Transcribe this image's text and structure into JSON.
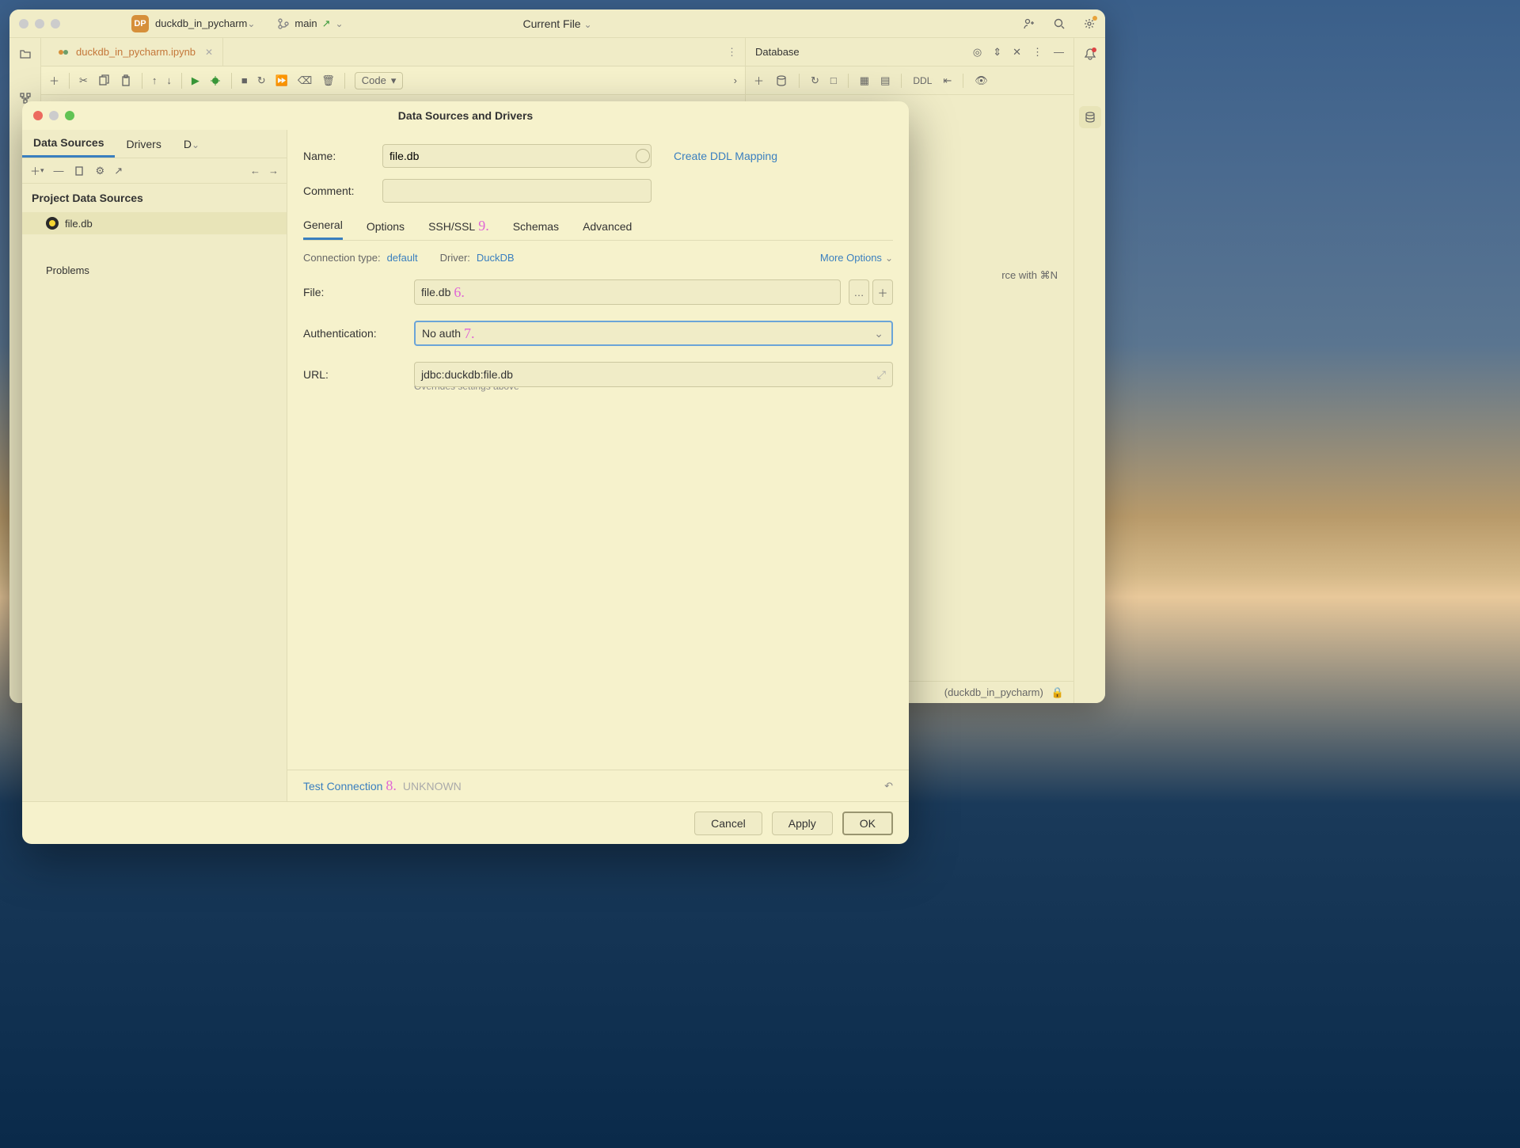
{
  "window": {
    "project_badge": "DP",
    "project_name": "duckdb_in_pycharm",
    "branch": "main",
    "current_file": "Current File"
  },
  "tabs": {
    "file": "duckdb_in_pycharm.ipynb"
  },
  "editor_toolbar": {
    "code_label": "Code"
  },
  "database_panel": {
    "title": "Database",
    "ddl": "DDL",
    "hint": "rce with ⌘N"
  },
  "status_bar": {
    "venv": "(duckdb_in_pycharm)"
  },
  "modal": {
    "title": "Data Sources and Drivers",
    "left_tabs": [
      "Data Sources",
      "Drivers",
      "D"
    ],
    "section_title": "Project Data Sources",
    "item_name": "file.db",
    "problems": "Problems",
    "name_label": "Name:",
    "name_value": "file.db",
    "comment_label": "Comment:",
    "create_ddl": "Create DDL Mapping",
    "general_tabs": [
      "General",
      "Options",
      "SSH/SSL",
      "Schemas",
      "Advanced"
    ],
    "conn_type_label": "Connection type:",
    "conn_type_value": "default",
    "driver_label": "Driver:",
    "driver_value": "DuckDB",
    "more_options": "More Options",
    "file_label": "File:",
    "file_value": "file.db",
    "auth_label": "Authentication:",
    "auth_value": "No auth",
    "url_label": "URL:",
    "url_value": "jdbc:duckdb:file.db",
    "url_hint": "Overrides settings above",
    "test_connection": "Test Connection",
    "test_status": "UNKNOWN",
    "buttons": {
      "cancel": "Cancel",
      "apply": "Apply",
      "ok": "OK"
    }
  },
  "annotations": {
    "6": "6.",
    "7": "7.",
    "8": "8.",
    "9": "9."
  }
}
